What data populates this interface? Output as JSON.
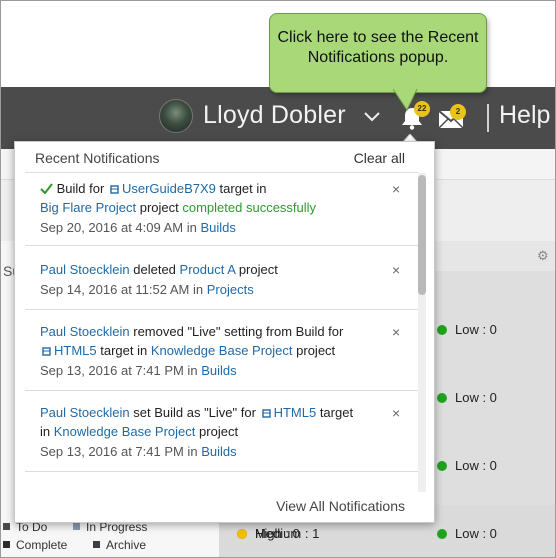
{
  "callout": {
    "text_line1": "Click here to see the Recent",
    "text_line2": "Notifications popup."
  },
  "header": {
    "user_name": "Lloyd Dobler",
    "notifications_count": "22",
    "messages_count": "2",
    "help_label": "Help"
  },
  "background": {
    "partial_label": "Su",
    "status_rows": [
      {
        "label": "Low : 0",
        "color": "#1fa31f"
      },
      {
        "label": "Low : 0",
        "color": "#1fa31f"
      },
      {
        "label": "Low : 0",
        "color": "#1fa31f"
      },
      {
        "label": "Low : 0",
        "color": "#1fa31f"
      }
    ],
    "bottom_counts": [
      {
        "label": "High : 0",
        "color": "#e02020"
      },
      {
        "label": "Medium : 1",
        "color": "#f0c000"
      },
      {
        "label": "Low : 0",
        "color": "#1fa31f"
      }
    ],
    "legend": [
      {
        "label": "To Do",
        "color": "#4a4a4a"
      },
      {
        "label": "In Progress",
        "color": "#8a9bb0"
      },
      {
        "label": "Complete",
        "color": "#2b2b2b"
      },
      {
        "label": "Archive",
        "color": "#3a3f46"
      }
    ]
  },
  "popup": {
    "title": "Recent Notifications",
    "clear_all": "Clear all",
    "view_all": "View All Notifications",
    "close_glyph": "×",
    "notifications": [
      {
        "prefix": "Build for",
        "target": "UserGuideB7X9",
        "mid": "target in",
        "project": "Big Flare Project",
        "project_word": "project",
        "status": "completed successfully",
        "date": "Sep 20, 2016 at 4:09 AM in",
        "category": "Builds"
      },
      {
        "user": "Paul Stoecklein",
        "action": "deleted",
        "object": "Product A",
        "object_word": "project",
        "date": "Sep 14, 2016 at 11:52 AM in",
        "category": "Projects"
      },
      {
        "user": "Paul Stoecklein",
        "action": "removed \"Live\" setting from Build for",
        "target": "HTML5",
        "mid": "target in",
        "project": "Knowledge Base Project",
        "project_word": "project",
        "date": "Sep 13, 2016 at 7:41 PM in",
        "category": "Builds"
      },
      {
        "user": "Paul Stoecklein",
        "action": "set Build as \"Live\" for",
        "target": "HTML5",
        "mid": "target",
        "in_word": "in",
        "project": "Knowledge Base Project",
        "project_word": "project",
        "date": "Sep 13, 2016 at 7:41 PM in",
        "category": "Builds"
      }
    ]
  }
}
